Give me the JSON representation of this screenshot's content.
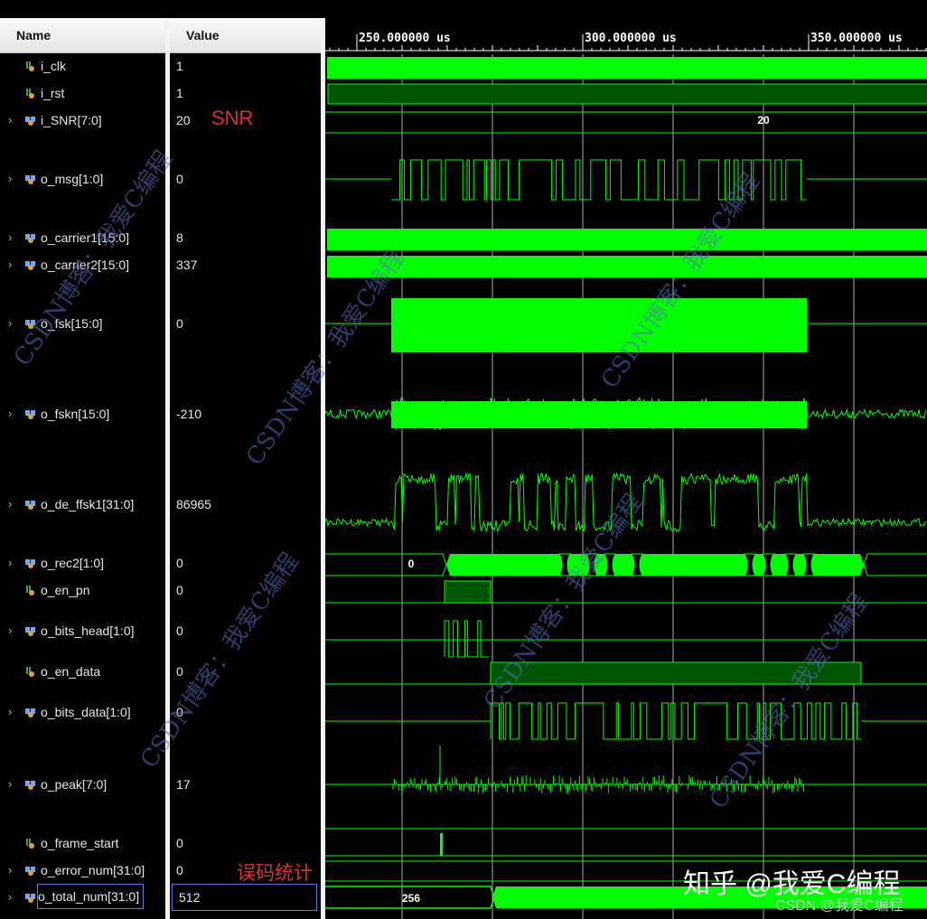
{
  "header": {
    "name_label": "Name",
    "value_label": "Value"
  },
  "ruler": {
    "labels": [
      "250.000000 us",
      "300.000000 us",
      "350.000000 us"
    ]
  },
  "signals": [
    {
      "name": "i_clk",
      "value": "1",
      "kind": "bit"
    },
    {
      "name": "i_rst",
      "value": "1",
      "kind": "bit"
    },
    {
      "name": "i_SNR[7:0]",
      "value": "20",
      "kind": "bus",
      "wave_label": "20"
    },
    {
      "name": "o_msg[1:0]",
      "value": "0",
      "kind": "bus"
    },
    {
      "name": "o_carrier1[15:0]",
      "value": "8",
      "kind": "bus"
    },
    {
      "name": "o_carrier2[15:0]",
      "value": "337",
      "kind": "bus"
    },
    {
      "name": "o_fsk[15:0]",
      "value": "0",
      "kind": "bus"
    },
    {
      "name": "o_fskn[15:0]",
      "value": "-210",
      "kind": "bus"
    },
    {
      "name": "o_de_ffsk1[31:0]",
      "value": "86965",
      "kind": "bus"
    },
    {
      "name": "o_rec2[1:0]",
      "value": "0",
      "kind": "bus",
      "wave_label": "0"
    },
    {
      "name": "o_en_pn",
      "value": "0",
      "kind": "bit"
    },
    {
      "name": "o_bits_head[1:0]",
      "value": "0",
      "kind": "bus"
    },
    {
      "name": "o_en_data",
      "value": "0",
      "kind": "bit"
    },
    {
      "name": "o_bits_data[1:0]",
      "value": "0",
      "kind": "bus"
    },
    {
      "name": "o_peak[7:0]",
      "value": "17",
      "kind": "bus"
    },
    {
      "name": "o_frame_start",
      "value": "0",
      "kind": "bit"
    },
    {
      "name": "o_error_num[31:0]",
      "value": "0",
      "kind": "bus"
    },
    {
      "name": "o_total_num[31:0]",
      "value": "512",
      "kind": "bus",
      "wave_label": "256",
      "selected": true
    }
  ],
  "annotations": {
    "snr": "SNR",
    "error_stats": "误码统计"
  },
  "watermarks": {
    "diagonal": "CSDN博客：我爱C编程",
    "zhihu": "知乎 @我爱C编程",
    "csdn": "CSDN @我爱C编程"
  },
  "waveform_events_us": {
    "msg_start": 257.6,
    "msg_end": 349.6,
    "pn_start": 269.4,
    "data_start": 279.6,
    "data_end": 361.6,
    "frame_start_pulse": 268.4
  },
  "colors": {
    "wave": "#00ff00",
    "wave_dark": "#005500",
    "grid": "#d8d8d8",
    "annotation": "#e03030"
  }
}
